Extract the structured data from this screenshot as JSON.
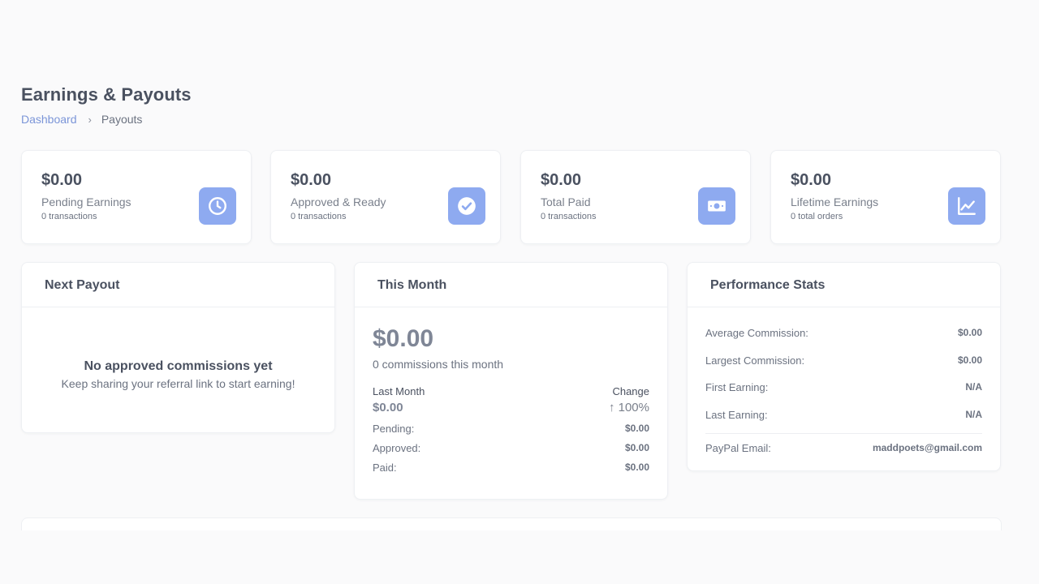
{
  "header": {
    "title": "Earnings & Payouts",
    "breadcrumb": {
      "home": "Dashboard",
      "separator": "›",
      "current": "Payouts"
    }
  },
  "stats": [
    {
      "amount": "$0.00",
      "label": "Pending Earnings",
      "sub": "0 transactions",
      "icon": "clock-icon"
    },
    {
      "amount": "$0.00",
      "label": "Approved & Ready",
      "sub": "0 transactions",
      "icon": "check-circle-icon"
    },
    {
      "amount": "$0.00",
      "label": "Total Paid",
      "sub": "0 transactions",
      "icon": "money-icon"
    },
    {
      "amount": "$0.00",
      "label": "Lifetime Earnings",
      "sub": "0 total orders",
      "icon": "chart-line-icon"
    }
  ],
  "next_payout": {
    "title": "Next Payout",
    "empty_title": "No approved commissions yet",
    "empty_sub": "Keep sharing your referral link to start earning!"
  },
  "this_month": {
    "title": "This Month",
    "amount": "$0.00",
    "count": "0 commissions this month",
    "last_month_label": "Last Month",
    "last_month_value": "$0.00",
    "change_label": "Change",
    "change_arrow": "↑",
    "change_value": "100%",
    "rows": [
      {
        "label": "Pending:",
        "value": "$0.00"
      },
      {
        "label": "Approved:",
        "value": "$0.00"
      },
      {
        "label": "Paid:",
        "value": "$0.00"
      }
    ]
  },
  "performance": {
    "title": "Performance Stats",
    "rows": [
      {
        "label": "Average Commission:",
        "value": "$0.00"
      },
      {
        "label": "Largest Commission:",
        "value": "$0.00"
      },
      {
        "label": "First Earning:",
        "value": "N/A"
      },
      {
        "label": "Last Earning:",
        "value": "N/A"
      }
    ],
    "paypal_label": "PayPal Email:",
    "paypal_value": "maddpoets@gmail.com"
  },
  "colors": {
    "accent": "#8eaaf0",
    "link": "#7b95d8",
    "background": "#fafafb"
  }
}
